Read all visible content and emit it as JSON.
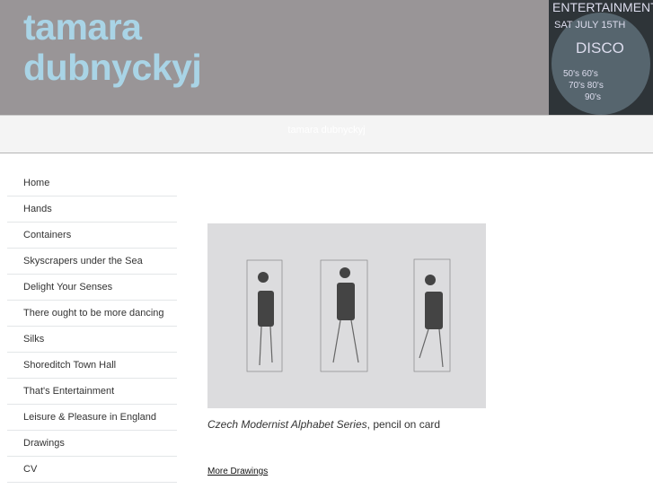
{
  "header": {
    "title_line1": "tamara",
    "title_line2": "dubnyckyj",
    "banner_text": [
      "ENTERTAINMENT",
      "SAT JULY 15TH",
      "DISCO",
      "50's 60's",
      "70's 80's",
      "90's"
    ]
  },
  "subbar": {
    "site_name": "tamara dubnyckyj"
  },
  "nav": {
    "items": [
      "Home",
      "Hands",
      "Containers",
      "Skyscrapers under the Sea",
      "Delight Your Senses",
      "There ought to be more dancing",
      "Silks",
      "Shoreditch Town Hall",
      "That's Entertainment",
      "Leisure & Pleasure in England",
      "Drawings",
      "CV"
    ]
  },
  "content": {
    "caption_title": "Czech Modernist Alphabet Series",
    "caption_rest": ", pencil on card",
    "more_link": "More Drawings "
  }
}
